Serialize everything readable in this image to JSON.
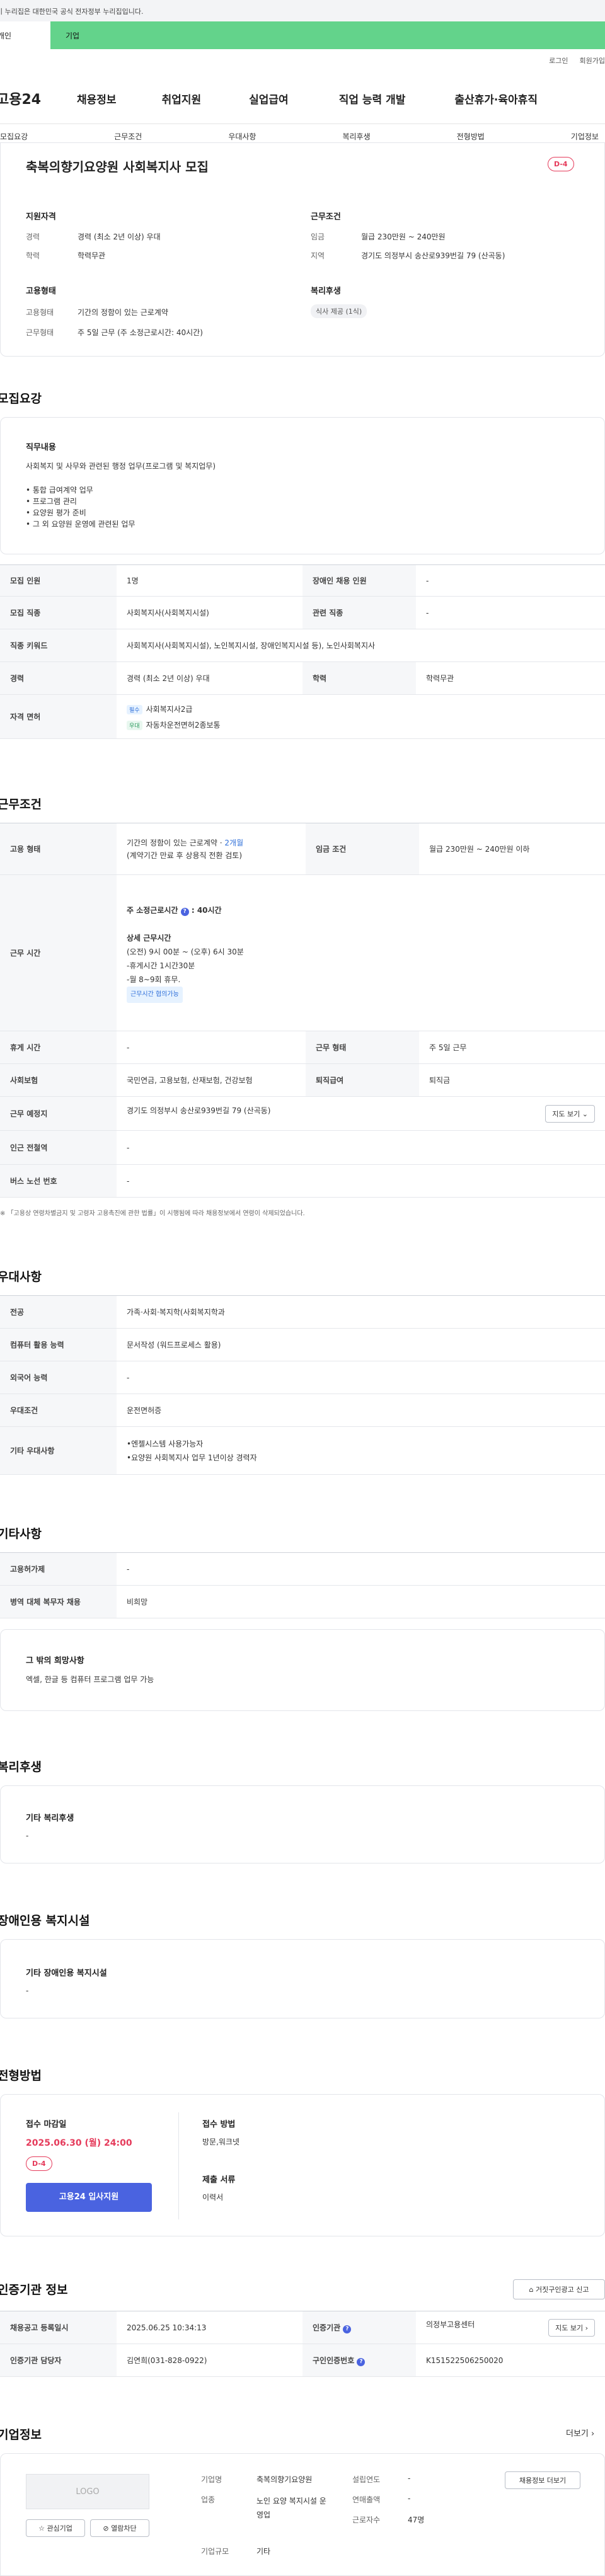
{
  "gov_banner": "이 누리집은 대한민국 공식 전자정부 누리집입니다.",
  "top_tabs": {
    "individual": "개인",
    "business": "기업"
  },
  "util": [
    "로그인",
    "회원가입"
  ],
  "logo": "고용24",
  "gnb": [
    "채용정보",
    "취업지원",
    "실업급여",
    "직업 능력 개발",
    "출산휴가·육아휴직"
  ],
  "subnav": [
    "모집요강",
    "근무조건",
    "우대사항",
    "복리후생",
    "전형방법",
    "기업정보"
  ],
  "summary": {
    "title": "축복의향기요양원 사회복지사 모집",
    "dday": "D-4",
    "qual_title": "지원자격",
    "career_label": "경력",
    "career_value": "경력 (최소 2년 이상) 우대",
    "edu_label": "학력",
    "edu_value": "학력무관",
    "work_title": "근무조건",
    "wage_label": "임금",
    "wage_value": "월급 230만원 ~ 240만원",
    "region_label": "지역",
    "region_value": "경기도 의정부시 송산로939번길 79 (산곡동)",
    "emp_title": "고용형태",
    "emptype_label": "고용형태",
    "emptype_value": "기간의 정함이 있는 근로계약",
    "worktype_label": "근무형태",
    "worktype_value": "주 5일 근무 (주 소정근로시간: 40시간)",
    "welfare_title": "복리후생",
    "welfare_pill": "식사 제공 (1식)"
  },
  "recruit": {
    "section_title": "모집요강",
    "duty_title": "직무내용",
    "duty_intro": "사회복지 및 사무와 관련된 행정 업무(프로그램 및 복지업무)",
    "duty_items": [
      "• 통합 급여계약 업무",
      "• 프로그램 관리",
      "• 요양원 평가 준비",
      "• 그 외 요양원 운영에 관련된 업무"
    ],
    "rows": {
      "headcount_label": "모집 인원",
      "headcount": "1명",
      "disabled_label": "장애인 채용 인원",
      "disabled": "-",
      "job_label": "모집 직종",
      "job": "사회복지사(사회복지시설)",
      "related_label": "관련 직종",
      "related": "-",
      "keyword_label": "직종 키워드",
      "keyword": "사회복지사(사회복지시설), 노인복지시설, 장애인복지시설 등), 노인사회복지사",
      "career_label": "경력",
      "career": "경력 (최소 2년 이상) 우대",
      "edu_label": "학력",
      "edu": "학력무관",
      "license_label": "자격 면허",
      "license_req_tag": "필수",
      "license_req": "사회복지사2급",
      "license_pref_tag": "우대",
      "license_pref": "자동차운전면허2종보통"
    }
  },
  "conditions": {
    "section_title": "근무조건",
    "emp_label": "고용 형태",
    "emp_value": "기간의 정함이 있는 근로계약 ·",
    "emp_months": "2개월",
    "emp_note": "(계약기간 만료 후 상용직 전환 검토)",
    "wage_label": "임금 조건",
    "wage_value": "월급 230만원 ~ 240만원 이하",
    "hours_label": "근무 시간",
    "hours_weekly_label": "주 소정근로시간",
    "hours_weekly": "40시간",
    "hours_detail_title": "상세 근무시간",
    "hours_detail": [
      "(오전) 9시 00분 ~ (오후) 6시 30분",
      "-휴게시간 1시간30분",
      "-월 8~9회 휴무."
    ],
    "hours_tag": "근무시간 협의가능",
    "break_label": "휴게 시간",
    "break_value": "-",
    "worktype_label": "근무 형태",
    "worktype_value": "주 5일 근무",
    "insurance_label": "사회보험",
    "insurance_value": "국민연금, 고용보험, 산재보험, 건강보험",
    "severance_label": "퇴직급여",
    "severance_value": "퇴직금",
    "place_label": "근무 예정지",
    "place_value": "경기도 의정부시 송산로939번길 79 (산곡동)",
    "map_btn": "지도 보기",
    "subway_label": "인근 전철역",
    "subway_value": "-",
    "bus_label": "버스 노선 번호",
    "bus_value": "-",
    "footnote": "「고용상 연령차별금지 및 고령자 고용촉진에 관한 법률」이 시행됨에 따라 채용정보에서 연령이 삭제되었습니다."
  },
  "preferred": {
    "section_title": "우대사항",
    "major_label": "전공",
    "major_value": "가족·사회·복지학(사회복지학과",
    "computer_label": "컴퓨터 활용 능력",
    "computer_value": "문서작성 (워드프로세스 활용)",
    "language_label": "외국어 능력",
    "language_value": "-",
    "cond_label": "우대조건",
    "cond_value": "운전면허증",
    "etc_label": "기타 우대사항",
    "etc_values": [
      "•엔젤시스템 사용가능자",
      "•요양원 사회복지사 업무 1년이상 경력자"
    ]
  },
  "etc": {
    "section_title": "기타사항",
    "elder_label": "고용허가제",
    "elder_value": "-",
    "military_label": "병역 대체 복무자 채용",
    "military_value": "비희망",
    "other_title": "그 밖의 희망사항",
    "other_value": "엑셀, 한글 등 컴퓨터 프로그램 업무 가능"
  },
  "welfare": {
    "section_title": "복리후생",
    "sub_title": "기타 복리후생",
    "value": "-"
  },
  "disabled_facility": {
    "section_title": "장애인용 복지시설",
    "sub_title": "기타 장애인용 복지시설",
    "value": "-"
  },
  "selection": {
    "section_title": "전형방법",
    "deadline_label": "접수 마감일",
    "deadline_value": "2025.06.30 (월) 24:00",
    "dday": "D-4",
    "apply_btn": "고용24 입사지원",
    "method_label": "접수 방법",
    "method_value": "방문,워크넷",
    "docs_label": "제출 서류",
    "docs_value": "이력서"
  },
  "agency": {
    "section_title": "인증기관 정보",
    "report_btn": "거짓구인광고 신고",
    "reg_label": "채용공고 등록일시",
    "reg_value": "2025.06.25 10:34:13",
    "org_label": "인증기관",
    "org_value": "의정부고용센터",
    "map_btn": "지도 보기",
    "manager_label": "인증기관 담당자",
    "manager_value": "김연희(031-828-0922)",
    "job_no_label": "구인인증번호",
    "job_no_value": "K151522506250020"
  },
  "company": {
    "section_title": "기업정보",
    "more": "더보기",
    "logo_text": "LOGO",
    "interest_btn": "관심기업",
    "block_btn": "열람차단",
    "name_label": "기업명",
    "name_value": "축복의향기요양원",
    "industry_label": "업종",
    "industry_value": "노인 요양 복지시설 운영업",
    "size_label": "기업규모",
    "size_value": "기타",
    "founded_label": "설립연도",
    "founded_value": "-",
    "revenue_label": "연매출액",
    "revenue_value": "-",
    "employees_label": "근로자수",
    "employees_value": "47명",
    "jobs_btn": "채용정보 더보기"
  },
  "colors": {
    "accent": "#4a63e0",
    "brand_green": "#63d38b",
    "dday": "#e53b5b"
  }
}
